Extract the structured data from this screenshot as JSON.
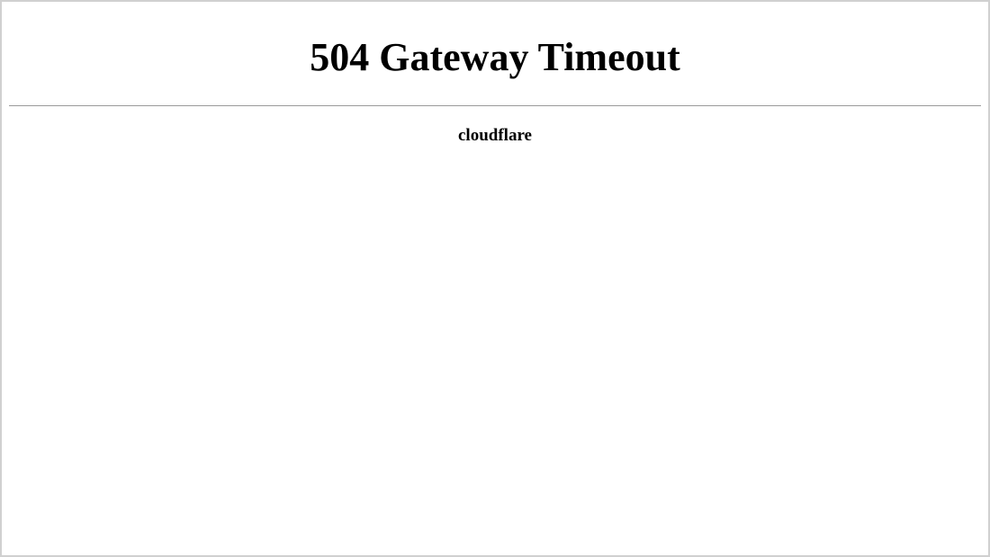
{
  "error": {
    "heading": "504 Gateway Timeout",
    "provider": "cloudflare"
  }
}
